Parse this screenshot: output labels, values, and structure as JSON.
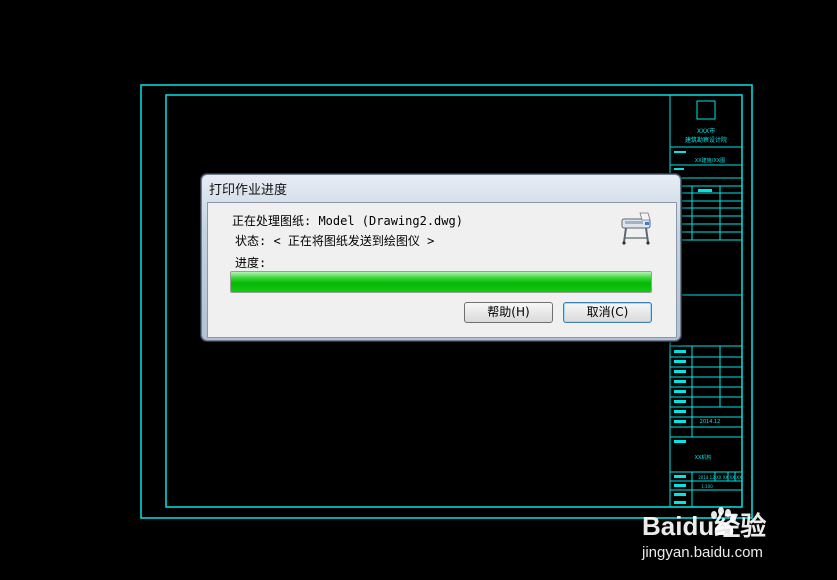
{
  "dialog": {
    "title": "打印作业进度",
    "processing_line": "正在处理图纸: Model (Drawing2.dwg)",
    "status_line": "状态: < 正在将图纸发送到绘图仪 >",
    "progress_label": "进度:",
    "progress_fraction": 1.0,
    "help_button": "帮助(H)",
    "cancel_button": "取消(C)",
    "icon": "plotter-icon"
  },
  "title_block": {
    "project_line1": "XXX市",
    "project_line2": "建筑勘察设计院",
    "drawing_no": "XX建施/XX图",
    "date": "2014.12",
    "company": "XX机构",
    "sheet_info": "2014.12   XX   XX  XX  XX",
    "scale": "1:100"
  },
  "watermark": {
    "brand": "Baidu经验",
    "url": "jingyan.baidu.com"
  },
  "colors": {
    "background": "#000000",
    "frame": "#00e5e5",
    "progress": "#07b807"
  }
}
